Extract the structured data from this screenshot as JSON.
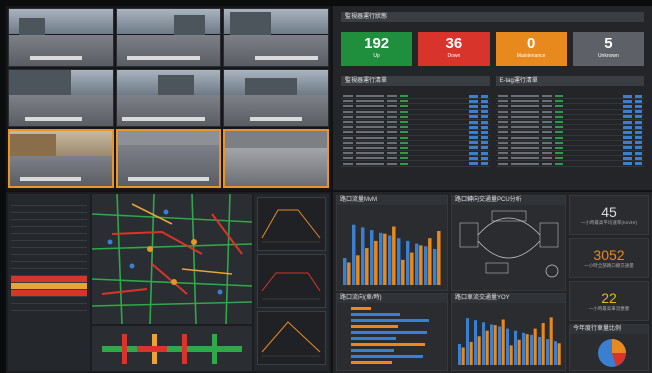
{
  "status": {
    "monitor_title": "監視器運行狀態",
    "cards": [
      {
        "value": "192",
        "label": "Up",
        "color": "#1f8f3d"
      },
      {
        "value": "36",
        "label": "Down",
        "color": "#d9342b"
      },
      {
        "value": "0",
        "label": "Maintenance",
        "color": "#e8891e"
      },
      {
        "value": "5",
        "label": "Unknown",
        "color": "#5d6066"
      }
    ],
    "table_left_title": "監視器運行清單",
    "table_right_title": "E-tag運行清單"
  },
  "analytics": {
    "mvm_title": "路口流量MvM",
    "pcu_title": "路口轉向交通量PCU分析",
    "dir_title": "路口流向(車/時)",
    "yoy_title": "路口車流交通量YOY",
    "pie_title": "今年度行車量比例",
    "kpis": [
      {
        "value": "45",
        "desc": "一小時最高平均速率(Km/Hr)",
        "color": "#ffffff"
      },
      {
        "value": "3052",
        "desc": "一小時全部路口總交通量",
        "color": "#e8891e"
      },
      {
        "value": "22",
        "desc": "一小時最高車流壅塞",
        "color": "#e8b21e"
      }
    ]
  },
  "colors": {
    "accent": "#e8962a",
    "up": "#1f8f3d",
    "down": "#d9342b"
  }
}
